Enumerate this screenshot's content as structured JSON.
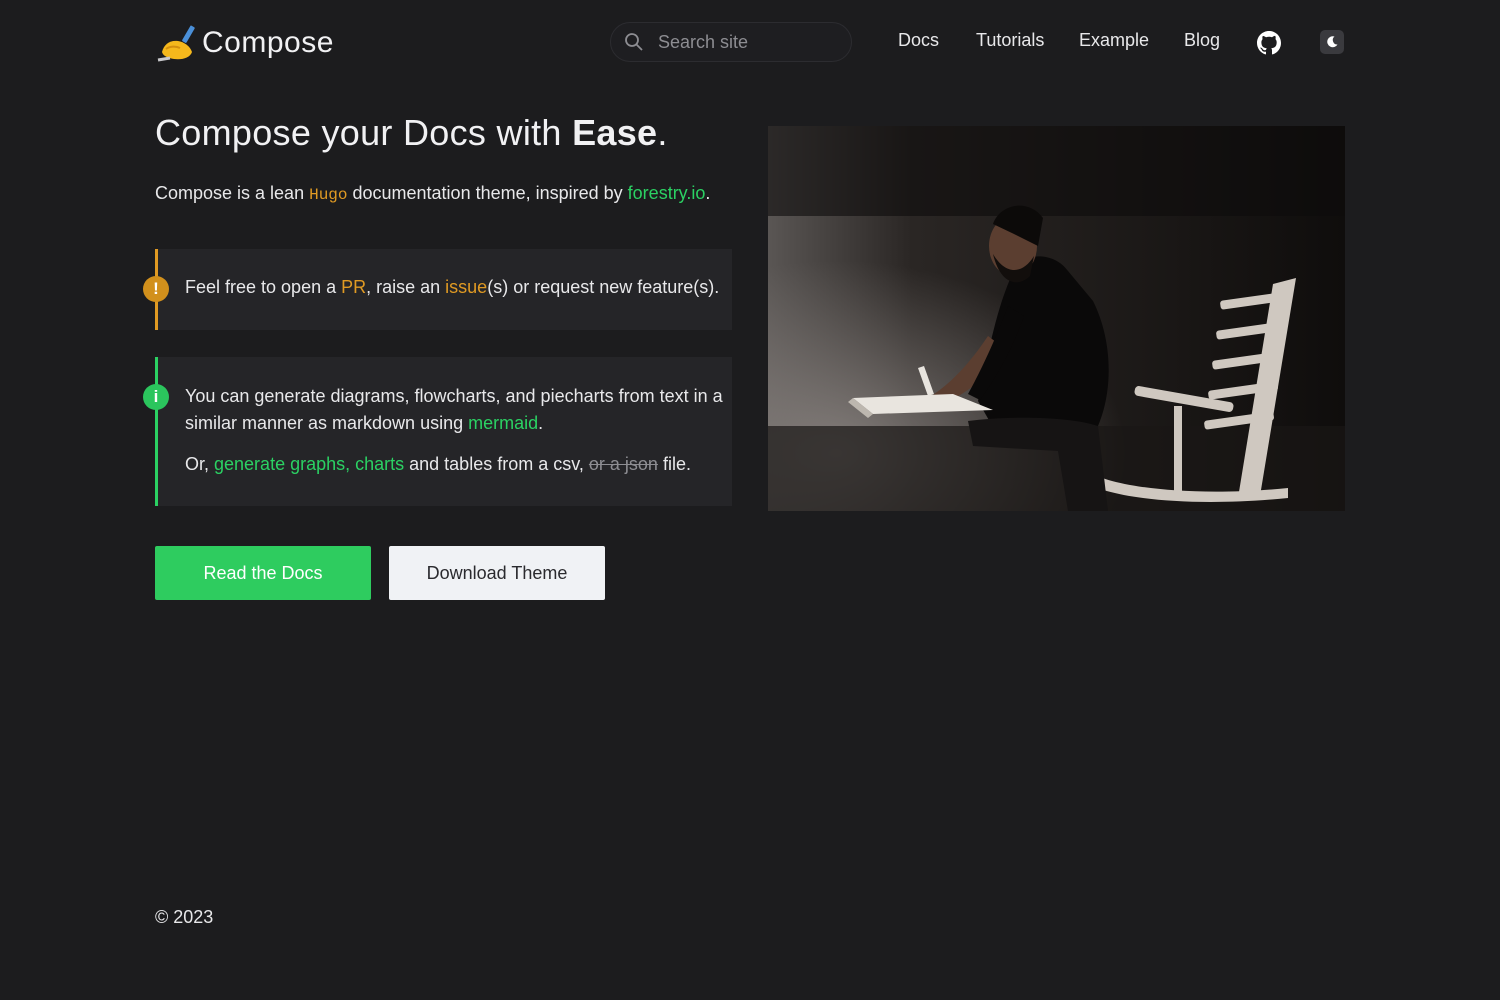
{
  "header": {
    "logo_text": "Compose",
    "search": {
      "placeholder": "Search site"
    },
    "nav": [
      {
        "label": "Docs"
      },
      {
        "label": "Tutorials"
      },
      {
        "label": "Example"
      },
      {
        "label": "Blog"
      }
    ],
    "icons": {
      "github": "github-icon",
      "theme": "moon-icon"
    }
  },
  "hero": {
    "title_plain": "Compose your Docs with ",
    "title_bold": "Ease",
    "title_end": ".",
    "lead": {
      "before": "Compose is a lean ",
      "code": "Hugo",
      "middle": " documentation theme, inspired by ",
      "link": "forestry.io",
      "end": "."
    }
  },
  "callouts": {
    "warning": {
      "icon_glyph": "!",
      "t1": "Feel free to open a ",
      "link1": "PR",
      "t2": ", raise an ",
      "link2": "issue",
      "t3": "(s) or request new feature(s)."
    },
    "info": {
      "icon_glyph": "i",
      "p1_text": "You can generate diagrams, flowcharts, and piecharts from text in a similar manner as markdown using ",
      "p1_link": "mermaid",
      "p1_end": ".",
      "p2_start": "Or, ",
      "p2_link": "generate graphs, charts",
      "p2_mid": " and tables from a csv, ",
      "p2_strike": "or a json",
      "p2_end": " file."
    }
  },
  "buttons": {
    "read_docs": "Read the Docs",
    "download": "Download Theme"
  },
  "footer": {
    "copyright": "© 2023"
  },
  "colors": {
    "background": "#1c1c1e",
    "accent_green": "#2bd163",
    "accent_orange": "#e09a23",
    "callout_bg": "#252528"
  }
}
